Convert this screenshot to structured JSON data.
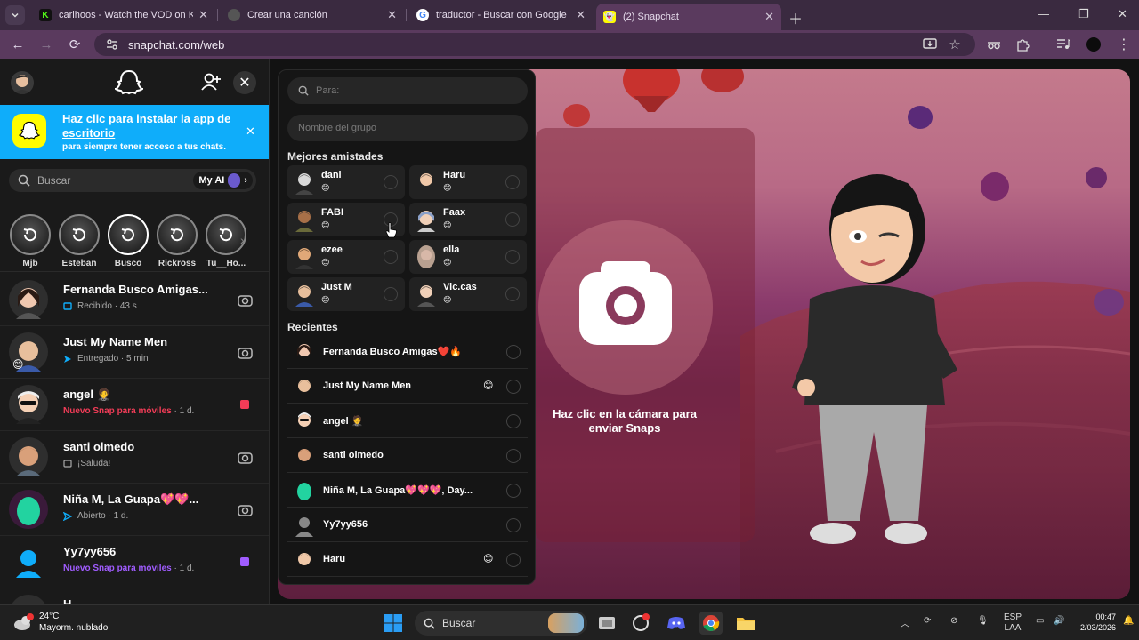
{
  "browser": {
    "tabs": [
      {
        "title": "carlhoos - Watch the VOD on K",
        "favicon": "kick-icon",
        "color": "#53fc18"
      },
      {
        "title": "Crear una canción",
        "favicon": "app-icon",
        "color": "#888888"
      },
      {
        "title": "traductor - Buscar con Google",
        "favicon": "google-icon",
        "color": "#ffffff"
      },
      {
        "title": "(2) Snapchat",
        "favicon": "snapchat-icon",
        "color": "#fffc00"
      }
    ],
    "url": "snapchat.com/web"
  },
  "banner": {
    "title": "Haz clic para instalar la app de escritorio",
    "subtitle": "para siempre tener acceso a tus chats."
  },
  "search": {
    "placeholder": "Buscar",
    "myai_label": "My AI"
  },
  "stories": [
    {
      "name": "Mjb"
    },
    {
      "name": "Esteban"
    },
    {
      "name": "Busco"
    },
    {
      "name": "Rickross"
    },
    {
      "name": "Tu__Ho..."
    }
  ],
  "chats": [
    {
      "name": "Fernanda Busco Amigas...",
      "status": "Recibido",
      "time": "43 s",
      "status_color": "#0fadfa",
      "action": "camera-icon"
    },
    {
      "name": "Just My Name Men",
      "status": "Entregado",
      "time": "5 min",
      "status_color": "#0fadfa",
      "action": "camera-icon"
    },
    {
      "name": "angel 🤵",
      "status": "Nuevo Snap para móviles",
      "time": "1 d.",
      "status_color": "#f23c57",
      "action": "red-square-icon"
    },
    {
      "name": "santi olmedo",
      "status": "¡Saluda!",
      "time": "",
      "status_color": "#aaaaaa",
      "action": "camera-icon"
    },
    {
      "name": "Niña M,  La Guapa💖💖...",
      "status": "Abierto",
      "time": "1 d.",
      "status_color": "#0fadfa",
      "action": "camera-icon"
    },
    {
      "name": "Yy7yy656",
      "status": "Nuevo Snap para móviles",
      "time": "1 d.",
      "status_color": "#a05cff",
      "action": "purple-square-icon"
    },
    {
      "name": "H...",
      "status": "",
      "time": "",
      "status_color": "#aaaaaa",
      "action": ""
    }
  ],
  "panel": {
    "to_placeholder": "Para:",
    "group_placeholder": "Nombre del grupo",
    "best_friends_label": "Mejores amistades",
    "best_friends": [
      {
        "name": "dani",
        "emoji": "😊"
      },
      {
        "name": "Haru",
        "emoji": "😊"
      },
      {
        "name": "FABI",
        "emoji": "😊"
      },
      {
        "name": "Faax",
        "emoji": "😊"
      },
      {
        "name": "ezee",
        "emoji": "😊"
      },
      {
        "name": "ella",
        "emoji": "😊"
      },
      {
        "name": "Just M",
        "emoji": "😊"
      },
      {
        "name": "Vic.cas",
        "emoji": "😊"
      }
    ],
    "recent_label": "Recientes",
    "recents": [
      {
        "name": "Fernanda Busco Amigas❤️🔥",
        "emoji": ""
      },
      {
        "name": "Just My Name Men",
        "emoji": "😊"
      },
      {
        "name": "angel 🤵",
        "emoji": ""
      },
      {
        "name": "santi olmedo",
        "emoji": ""
      },
      {
        "name": "Niña M,  La Guapa💖💖💖,  Day...",
        "emoji": ""
      },
      {
        "name": "Yy7yy656",
        "emoji": ""
      },
      {
        "name": "Haru",
        "emoji": "😊"
      }
    ]
  },
  "camera": {
    "hint": "Haz clic en la cámara para enviar Snaps"
  },
  "taskbar": {
    "temp": "24°C",
    "weather": "Mayorm. nublado",
    "search": "Buscar",
    "lang1": "ESP",
    "lang2": "LAA",
    "time": "00:47",
    "date": "2/03/2026"
  }
}
